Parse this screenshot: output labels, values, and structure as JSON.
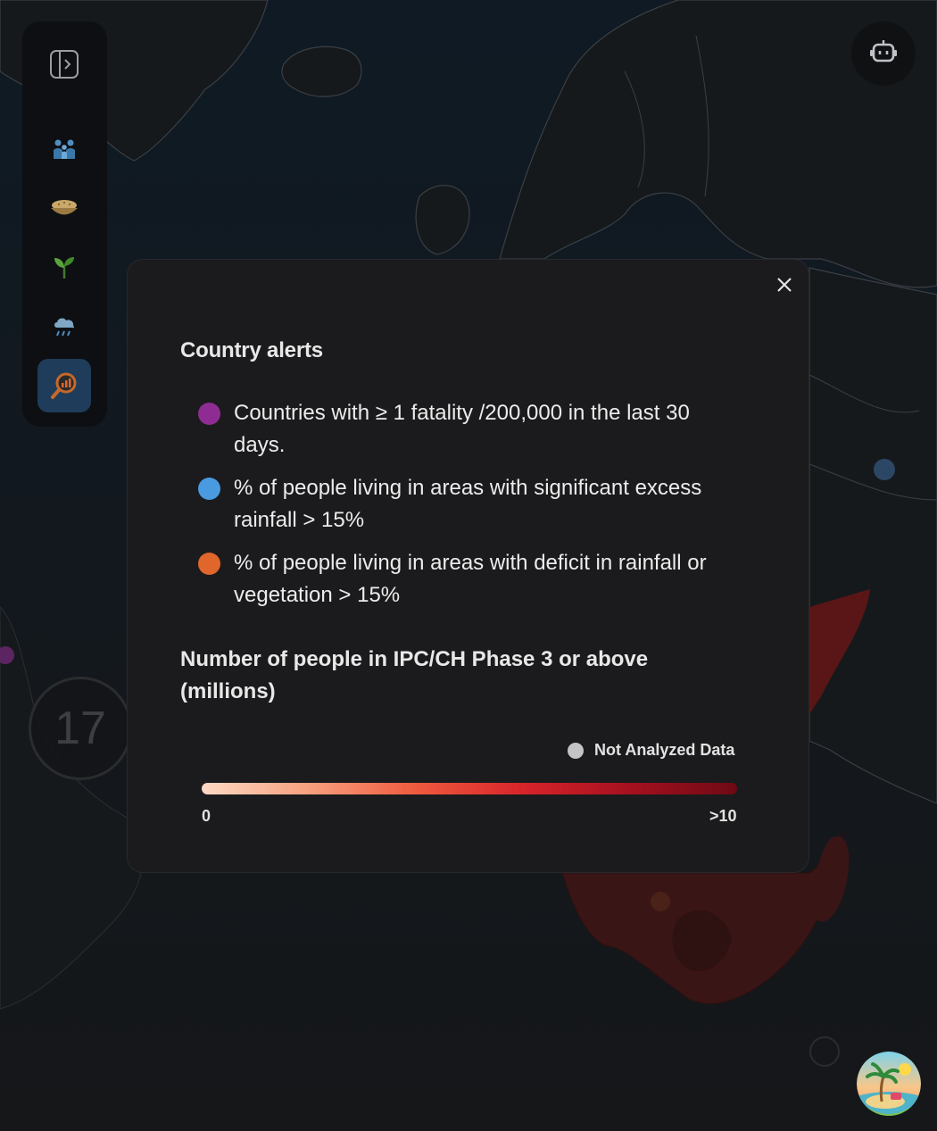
{
  "app": {
    "accent_active": "#1f3d5a",
    "background": "#12161b"
  },
  "sidebar": {
    "items": [
      {
        "icon": "panel-toggle-icon",
        "active": false
      },
      {
        "icon": "people-icon",
        "active": false
      },
      {
        "icon": "food-bowl-icon",
        "active": false
      },
      {
        "icon": "sprout-icon",
        "active": false
      },
      {
        "icon": "rain-cloud-icon",
        "active": false
      },
      {
        "icon": "analysis-magnifier-icon",
        "active": true
      }
    ]
  },
  "top_right": {
    "icon": "robot-icon"
  },
  "map": {
    "cluster_count": "17"
  },
  "legend_modal": {
    "close_icon": "close-icon",
    "country_alerts_title": "Country alerts",
    "alerts": [
      {
        "color": "#8e2c94",
        "text": "Countries with ≥ 1 fatality /200,000 in the last 30 days."
      },
      {
        "color": "#4a9ae0",
        "text": "% of people living in areas with significant excess rainfall > 15%"
      },
      {
        "color": "#e0662c",
        "text": "% of people living in areas with deficit in rainfall or vegetation > 15%"
      }
    ],
    "ipc_title": "Number of people in IPC/CH Phase 3 or above (millions)",
    "not_analyzed_label": "Not Analyzed Data",
    "not_analyzed_color": "#c4c4c4",
    "scale_min": "0",
    "scale_max": ">10",
    "gradient_colors": [
      "#fdd9c4",
      "#f7a07e",
      "#ef5a3e",
      "#d8242a",
      "#a5101f",
      "#6e0a14"
    ]
  },
  "avatar": {
    "icon": "tropical-island-avatar-icon"
  }
}
